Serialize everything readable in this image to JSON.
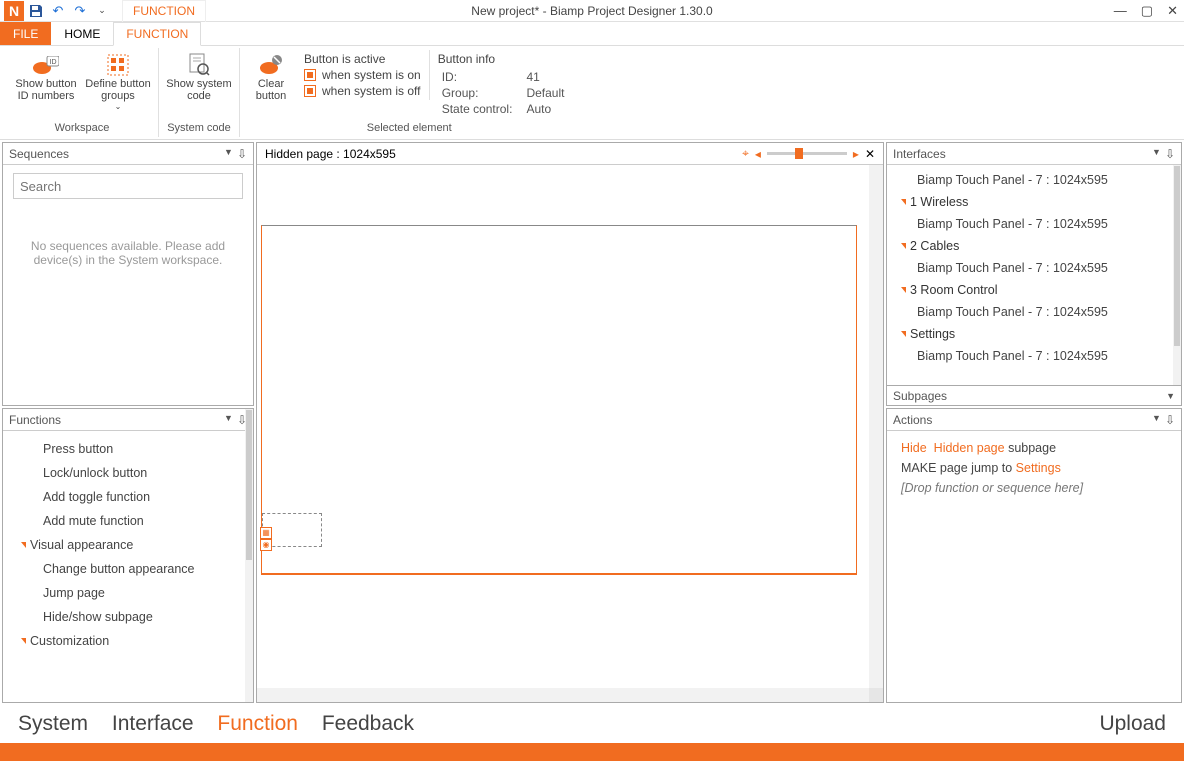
{
  "title": "New project* - Biamp Project Designer 1.30.0",
  "context_tab": "FUNCTION",
  "tabs": {
    "file": "FILE",
    "home": "HOME",
    "function": "FUNCTION"
  },
  "ribbon": {
    "workspace": {
      "label": "Workspace",
      "show_ids": "Show button ID numbers",
      "define_groups": "Define button groups"
    },
    "syscode": {
      "label": "System code",
      "show": "Show system code"
    },
    "selected": {
      "label": "Selected element",
      "clear": "Clear button",
      "active_label": "Button is active",
      "when_on": "when system is on",
      "when_off": "when system is off",
      "info_label": "Button info",
      "id_k": "ID:",
      "id_v": "41",
      "group_k": "Group:",
      "group_v": "Default",
      "state_k": "State control:",
      "state_v": "Auto"
    }
  },
  "sequences": {
    "title": "Sequences",
    "placeholder": "Search",
    "empty": "No sequences available. Please add device(s) in the System workspace."
  },
  "functions": {
    "title": "Functions",
    "items1": [
      "Press button",
      "Lock/unlock button",
      "Add toggle function",
      "Add mute function"
    ],
    "cat1": "Visual appearance",
    "items2": [
      "Change button appearance",
      "Jump page",
      "Hide/show subpage"
    ],
    "cat2": "Customization"
  },
  "canvas": {
    "title": "Hidden page : 1024x595"
  },
  "interfaces": {
    "title": "Interfaces",
    "entry": "Biamp Touch Panel - 7 : 1024x595",
    "cats": [
      "1 Wireless",
      "2 Cables",
      "3 Room Control",
      "Settings"
    ]
  },
  "subpages_title": "Subpages",
  "actions": {
    "title": "Actions",
    "l1a": "Hide",
    "l1b": "Hidden page",
    "l1c": "subpage",
    "l2a": "MAKE page jump to",
    "l2b": "Settings",
    "drop": "[Drop function or sequence here]"
  },
  "bottom": {
    "system": "System",
    "interface": "Interface",
    "function": "Function",
    "feedback": "Feedback",
    "upload": "Upload"
  }
}
